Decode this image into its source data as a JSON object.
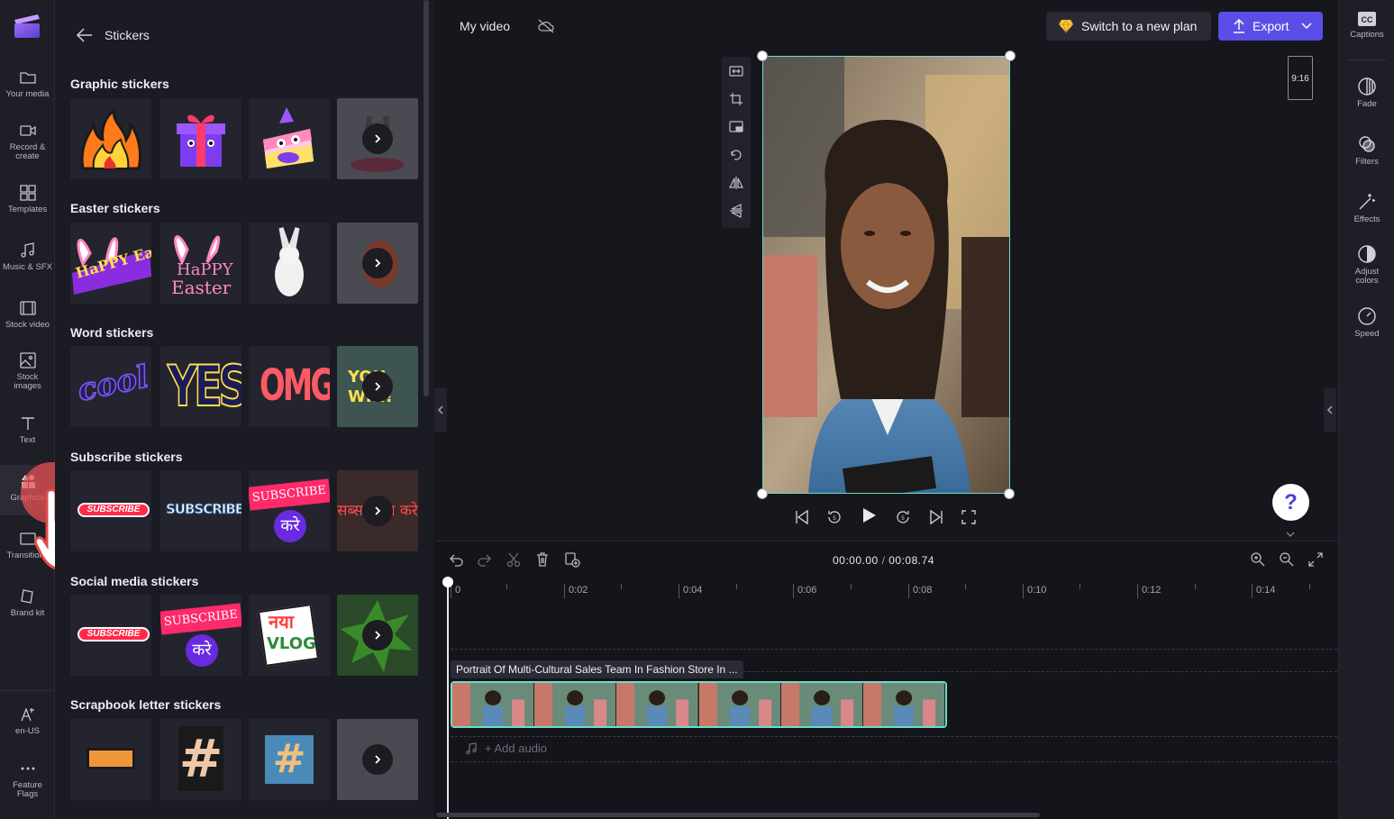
{
  "app": {
    "title": "My video"
  },
  "left_rail": {
    "items": [
      {
        "label": "Your media",
        "icon": "folder-icon"
      },
      {
        "label": "Record & create",
        "icon": "camera-icon"
      },
      {
        "label": "Templates",
        "icon": "templates-icon"
      },
      {
        "label": "Music & SFX",
        "icon": "music-icon"
      },
      {
        "label": "Stock video",
        "icon": "film-icon"
      },
      {
        "label": "Stock images",
        "icon": "image-icon"
      },
      {
        "label": "Text",
        "icon": "text-icon"
      },
      {
        "label": "Graphics",
        "icon": "shapes-icon",
        "active": true
      },
      {
        "label": "Transitions",
        "icon": "transition-icon"
      },
      {
        "label": "Brand kit",
        "icon": "brand-icon"
      }
    ],
    "bottom": [
      {
        "label": "en-US",
        "icon": "language-icon"
      },
      {
        "label": "Feature Flags",
        "icon": "more-icon"
      }
    ]
  },
  "panel": {
    "title": "Stickers",
    "sections": [
      {
        "title": "Graphic stickers"
      },
      {
        "title": "Easter stickers"
      },
      {
        "title": "Word stickers"
      },
      {
        "title": "Subscribe stickers"
      },
      {
        "title": "Social media stickers"
      },
      {
        "title": "Scrapbook letter stickers"
      }
    ],
    "sticker_text": {
      "happy_easter_1": "HaPPY Easter",
      "happy": "HaPPY",
      "easter": "Easter",
      "cool": "cool",
      "yes": "YES",
      "omg": "OMG",
      "you_win": "YOU WIN!",
      "subscribe": "SUBSCRIBE",
      "subscribe_big": "SUBSCRIBE",
      "subscribe_hindi": "SUBSCRIBE",
      "hindi_kare": "करे",
      "hindi_strip": "सब्सक्राइब करे",
      "naya": "नया",
      "vlog": "VLOG",
      "hash": "#"
    }
  },
  "topbar": {
    "plan_label": "Switch to a new plan",
    "export_label": "Export"
  },
  "right_rail": {
    "items": [
      {
        "label": "Captions",
        "icon": "captions-icon"
      },
      {
        "label": "Fade",
        "icon": "fade-icon"
      },
      {
        "label": "Filters",
        "icon": "filters-icon"
      },
      {
        "label": "Effects",
        "icon": "effects-icon"
      },
      {
        "label": "Adjust colors",
        "icon": "adjust-colors-icon"
      },
      {
        "label": "Speed",
        "icon": "speed-icon"
      }
    ]
  },
  "preview": {
    "aspect_ratio": "9:16",
    "help": "?"
  },
  "timeline": {
    "current_time": "00:00.00",
    "separator": "/",
    "total_time": "00:08.74",
    "ruler": [
      "0",
      "0:02",
      "0:04",
      "0:06",
      "0:08",
      "0:10",
      "0:12",
      "0:14"
    ],
    "clip_title": "Portrait Of Multi-Cultural Sales Team In Fashion Store In ...",
    "add_audio": "+ Add audio"
  },
  "colors": {
    "accent": "#5b4ee6",
    "selection": "#6bdcc6",
    "background": "#16161d"
  }
}
